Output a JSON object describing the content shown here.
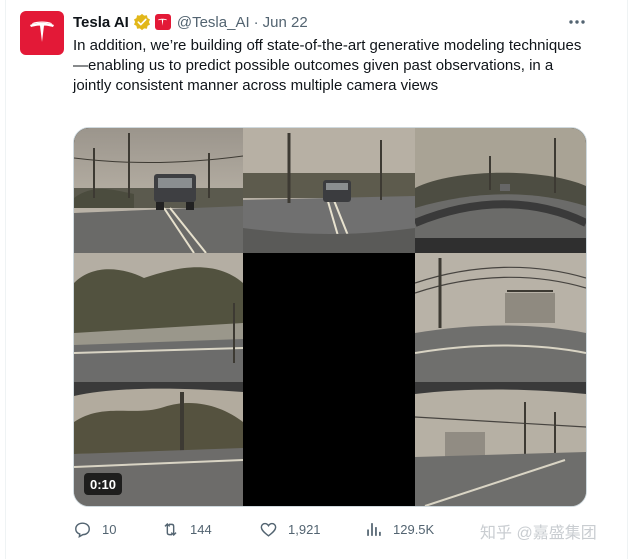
{
  "author": {
    "name": "Tesla AI",
    "handle": "@Tesla_AI",
    "separator": "·",
    "date": "Jun 22",
    "avatar_icon": "tesla-logo",
    "brand_color": "#e31937",
    "verified_color": "#e2b719"
  },
  "tweet": {
    "text": "In addition, we’re building off state-of-the-art generative modeling techniques—enabling us to predict possible outcomes given past observations, in a jointly consistent manner across multiple camera views"
  },
  "media": {
    "duration": "0:10"
  },
  "actions": {
    "replies": "10",
    "retweets": "144",
    "likes": "1,921",
    "views": "129.5K"
  },
  "watermark": "知乎 @嘉盛集团"
}
